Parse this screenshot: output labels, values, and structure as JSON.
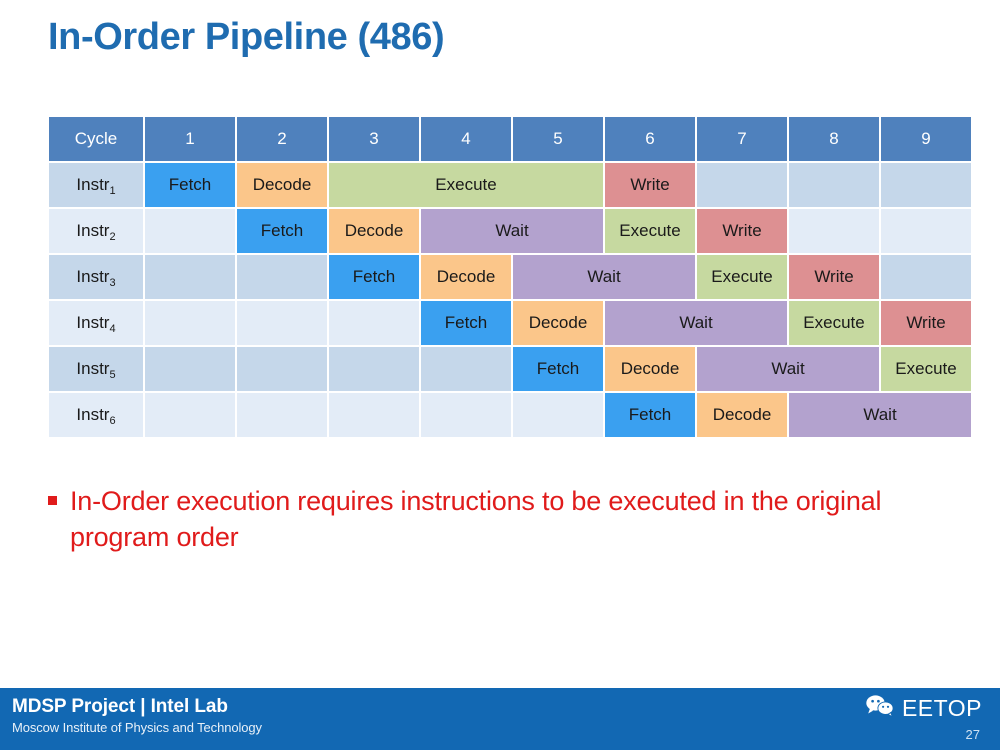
{
  "slide": {
    "title": "In-Order Pipeline (486)",
    "page_number": "27",
    "title_color": "#1f6cb0",
    "accent_color": "#1268b3",
    "bullet_color": "#e01b1b"
  },
  "table": {
    "label_header": "Cycle",
    "cycles": [
      "1",
      "2",
      "3",
      "4",
      "5",
      "6",
      "7",
      "8",
      "9"
    ],
    "row_labels": [
      {
        "base": "Instr",
        "index": "1"
      },
      {
        "base": "Instr",
        "index": "2"
      },
      {
        "base": "Instr",
        "index": "3"
      },
      {
        "base": "Instr",
        "index": "4"
      },
      {
        "base": "Instr",
        "index": "5"
      },
      {
        "base": "Instr",
        "index": "6"
      }
    ],
    "stage_colors": {
      "Fetch": "#3aa0f0",
      "Decode": "#fbc68a",
      "Execute": "#c6d9a0",
      "Wait": "#b3a2ce",
      "Write": "#dd9092",
      "empty_odd": "#c5d7ea",
      "empty_even": "#e3ecf7"
    },
    "rows": [
      {
        "label": "Instr1",
        "cells": [
          {
            "label": "Fetch",
            "stage": "fetch",
            "span": 1
          },
          {
            "label": "Decode",
            "stage": "decode",
            "span": 1
          },
          {
            "label": "Execute",
            "stage": "execute",
            "span": 3
          },
          {
            "label": "Write",
            "stage": "write",
            "span": 1
          },
          {
            "label": "",
            "stage": "empty",
            "span": 1
          },
          {
            "label": "",
            "stage": "empty",
            "span": 1
          },
          {
            "label": "",
            "stage": "empty",
            "span": 1
          }
        ]
      },
      {
        "label": "Instr2",
        "cells": [
          {
            "label": "",
            "stage": "empty",
            "span": 1
          },
          {
            "label": "Fetch",
            "stage": "fetch",
            "span": 1
          },
          {
            "label": "Decode",
            "stage": "decode",
            "span": 1
          },
          {
            "label": "Wait",
            "stage": "wait",
            "span": 2
          },
          {
            "label": "Execute",
            "stage": "execute",
            "span": 1
          },
          {
            "label": "Write",
            "stage": "write",
            "span": 1
          },
          {
            "label": "",
            "stage": "empty",
            "span": 1
          },
          {
            "label": "",
            "stage": "empty",
            "span": 1
          }
        ]
      },
      {
        "label": "Instr3",
        "cells": [
          {
            "label": "",
            "stage": "empty",
            "span": 1
          },
          {
            "label": "",
            "stage": "empty",
            "span": 1
          },
          {
            "label": "Fetch",
            "stage": "fetch",
            "span": 1
          },
          {
            "label": "Decode",
            "stage": "decode",
            "span": 1
          },
          {
            "label": "Wait",
            "stage": "wait",
            "span": 2
          },
          {
            "label": "Execute",
            "stage": "execute",
            "span": 1
          },
          {
            "label": "Write",
            "stage": "write",
            "span": 1
          },
          {
            "label": "",
            "stage": "empty",
            "span": 1
          }
        ]
      },
      {
        "label": "Instr4",
        "cells": [
          {
            "label": "",
            "stage": "empty",
            "span": 1
          },
          {
            "label": "",
            "stage": "empty",
            "span": 1
          },
          {
            "label": "",
            "stage": "empty",
            "span": 1
          },
          {
            "label": "Fetch",
            "stage": "fetch",
            "span": 1
          },
          {
            "label": "Decode",
            "stage": "decode",
            "span": 1
          },
          {
            "label": "Wait",
            "stage": "wait",
            "span": 2
          },
          {
            "label": "Execute",
            "stage": "execute",
            "span": 1
          },
          {
            "label": "Write",
            "stage": "write",
            "span": 1
          }
        ]
      },
      {
        "label": "Instr5",
        "cells": [
          {
            "label": "",
            "stage": "empty",
            "span": 1
          },
          {
            "label": "",
            "stage": "empty",
            "span": 1
          },
          {
            "label": "",
            "stage": "empty",
            "span": 1
          },
          {
            "label": "",
            "stage": "empty",
            "span": 1
          },
          {
            "label": "Fetch",
            "stage": "fetch",
            "span": 1
          },
          {
            "label": "Decode",
            "stage": "decode",
            "span": 1
          },
          {
            "label": "Wait",
            "stage": "wait",
            "span": 2
          },
          {
            "label": "Execute",
            "stage": "execute",
            "span": 1
          }
        ]
      },
      {
        "label": "Instr6",
        "cells": [
          {
            "label": "",
            "stage": "empty",
            "span": 1
          },
          {
            "label": "",
            "stage": "empty",
            "span": 1
          },
          {
            "label": "",
            "stage": "empty",
            "span": 1
          },
          {
            "label": "",
            "stage": "empty",
            "span": 1
          },
          {
            "label": "",
            "stage": "empty",
            "span": 1
          },
          {
            "label": "Fetch",
            "stage": "fetch",
            "span": 1
          },
          {
            "label": "Decode",
            "stage": "decode",
            "span": 1
          },
          {
            "label": "Wait",
            "stage": "wait",
            "span": 2
          }
        ]
      }
    ]
  },
  "bullet": {
    "text": "In-Order execution requires instructions to be executed in the original program order"
  },
  "footer": {
    "organization": "MDSP Project | Intel Lab",
    "institute": "Moscow Institute of Physics and Technology",
    "brand": "EETOP",
    "brand_icon": "wechat-icon",
    "page_number": "27"
  }
}
